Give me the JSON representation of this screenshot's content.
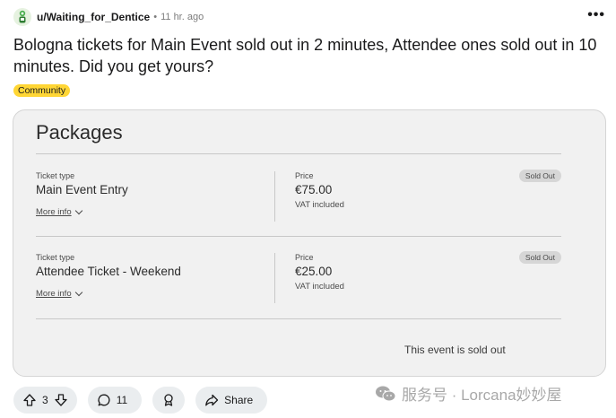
{
  "post": {
    "username": "u/Waiting_for_Dentice",
    "separator": "•",
    "time": "11 hr. ago",
    "more": "•••",
    "title": "Bologna tickets for Main Event sold out in 2 minutes, Attendee ones sold out in 10 minutes. Did you get yours?",
    "flair": "Community"
  },
  "packages": {
    "title": "Packages",
    "rows": [
      {
        "type_label": "Ticket type",
        "type_value": "Main Event Entry",
        "more_info": "More info",
        "price_label": "Price",
        "price_value": "€75.00",
        "vat": "VAT included",
        "status": "Sold Out"
      },
      {
        "type_label": "Ticket type",
        "type_value": "Attendee Ticket - Weekend",
        "more_info": "More info",
        "price_label": "Price",
        "price_value": "€25.00",
        "vat": "VAT included",
        "status": "Sold Out"
      }
    ],
    "sold_out_message": "This event is sold out"
  },
  "actions": {
    "votes": "3",
    "comments": "11",
    "share": "Share"
  },
  "watermark": "服务号 · Lorcana妙妙屋",
  "icons": [
    "avatar-icon",
    "upvote-icon",
    "downvote-icon",
    "comment-icon",
    "award-icon",
    "share-icon",
    "wechat-icon",
    "chevron-down-icon"
  ]
}
